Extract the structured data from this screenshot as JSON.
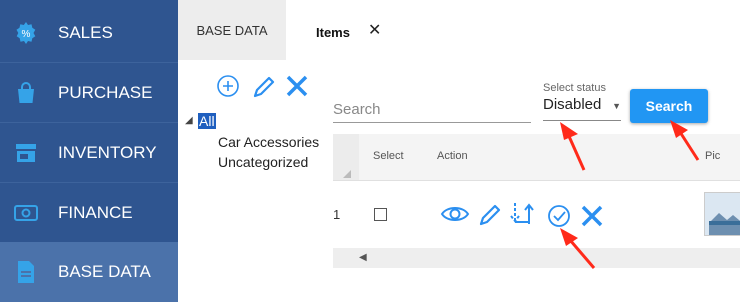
{
  "sidebar": {
    "items": [
      {
        "label": "SALES",
        "icon": "sales-gear-icon"
      },
      {
        "label": "PURCHASE",
        "icon": "shopping-bag-icon"
      },
      {
        "label": "INVENTORY",
        "icon": "store-icon"
      },
      {
        "label": "FINANCE",
        "icon": "money-bill-icon"
      },
      {
        "label": "BASE DATA",
        "icon": "document-icon",
        "active": true
      }
    ]
  },
  "tabs": [
    {
      "label": "BASE DATA"
    },
    {
      "label": "Items",
      "close_icon": "close-icon"
    }
  ],
  "tree": {
    "toolbar_icons": [
      "add-circle-icon",
      "edit-pencil-icon",
      "delete-x-icon"
    ],
    "root": "All",
    "children": [
      "Car Accessories",
      "Uncategorized"
    ]
  },
  "filters": {
    "search_placeholder": "Search",
    "status_label": "Select status",
    "status_value": "Disabled",
    "search_button": "Search"
  },
  "grid": {
    "columns": [
      "Select",
      "Action",
      "Pic"
    ],
    "rows": [
      {
        "num": "1",
        "selected": false,
        "actions": [
          "view-eye-icon",
          "edit-pencil-icon",
          "reorder-arrows-icon",
          "enable-check-circle-icon",
          "delete-x-icon"
        ]
      }
    ]
  },
  "colors": {
    "sidebar_bg": "#2f5590",
    "sidebar_active": "#4b72aa",
    "accent_blue": "#2196f3",
    "annotation_red": "#ff2a1a"
  }
}
